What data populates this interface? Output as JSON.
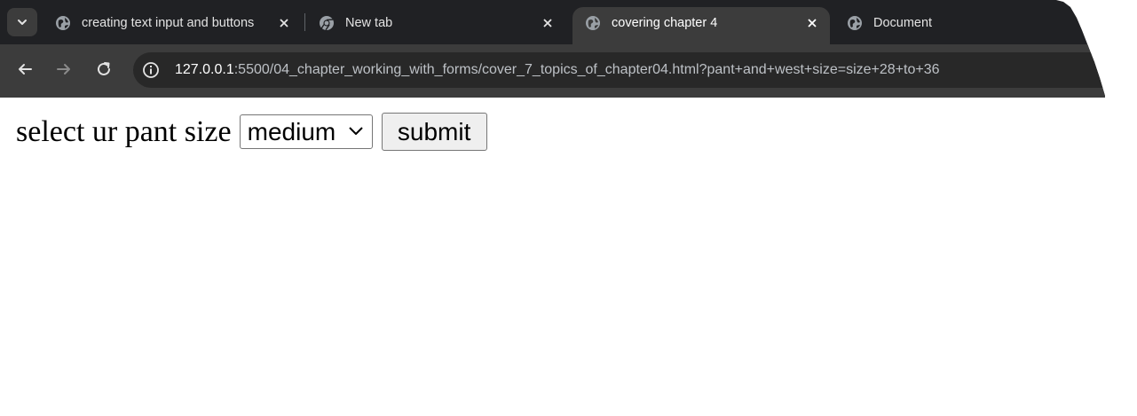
{
  "browser": {
    "tabs": [
      {
        "title": "creating text input and buttons",
        "icon": "globe-icon",
        "active": false
      },
      {
        "title": "New tab",
        "icon": "chrome-icon",
        "active": false
      },
      {
        "title": "covering chapter 4",
        "icon": "globe-icon",
        "active": true
      },
      {
        "title": "Document",
        "icon": "globe-icon",
        "active": false
      }
    ],
    "address": {
      "host": "127.0.0.1",
      "rest": ":5500/04_chapter_working_with_forms/cover_7_topics_of_chapter04.html?pant+and+west+size=size+28+to+36"
    }
  },
  "page": {
    "label": "select ur pant size",
    "select_value": "medium",
    "submit_label": "submit"
  },
  "colors": {
    "tabstrip_bg": "#202124",
    "toolbar_bg": "#3c3c3c",
    "omnibox_bg": "#282828"
  }
}
